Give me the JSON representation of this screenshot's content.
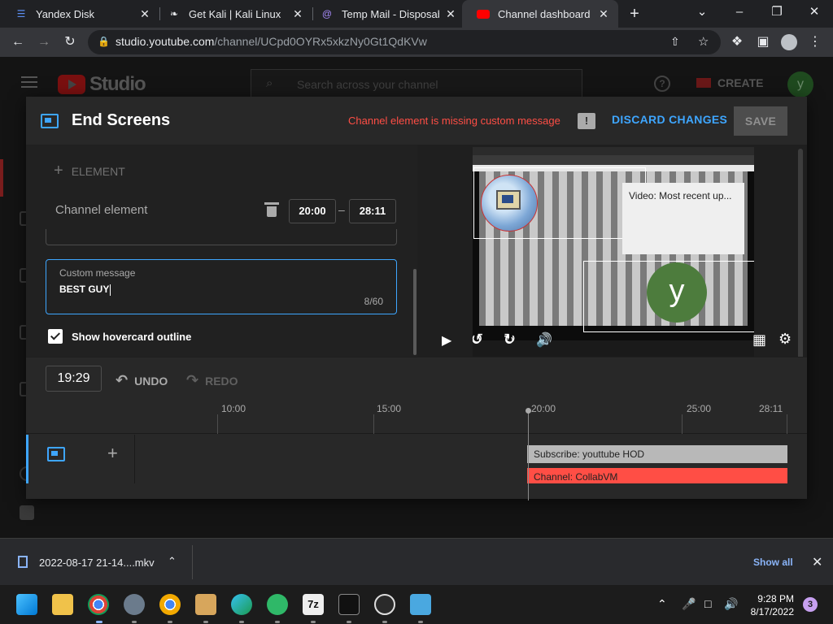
{
  "browser": {
    "tabs": [
      {
        "label": "Yandex Disk",
        "favicon": "yandex-disk-icon",
        "color": "#5b8def",
        "active": false
      },
      {
        "label": "Get Kali | Kali Linux",
        "favicon": "kali-dragon-icon",
        "color": "#e8eaed",
        "active": false
      },
      {
        "label": "Temp Mail - Disposable",
        "favicon": "at-sign-icon",
        "color": "#a78bfa",
        "active": false
      },
      {
        "label": "Channel dashboard - Y",
        "favicon": "youtube-icon",
        "color": "#ff0000",
        "active": true
      }
    ],
    "url_host": "studio.youtube.com",
    "url_path": "/channel/UCpd0OYRx5xkzNy0Gt1QdKVw"
  },
  "studio": {
    "brand": "Studio",
    "search_placeholder": "Search across your channel",
    "create_label": "CREATE",
    "avatar_letter": "y"
  },
  "dialog": {
    "title": "End Screens",
    "error": "Channel element is missing custom message",
    "discard_label": "DISCARD CHANGES",
    "save_label": "SAVE",
    "add_element_label": "ELEMENT",
    "element_name": "Channel element",
    "start_time": "20:00",
    "end_time": "28:11",
    "custom_message_label": "Custom message",
    "custom_message_value": "BEST GUY",
    "custom_message_count": "8/60",
    "hovercard_label": "Show hovercard outline",
    "hovercard_checked": true
  },
  "preview": {
    "video_card_text": "Video: Most recent up...",
    "subscribe_letter": "y"
  },
  "timeline": {
    "current_time": "19:29",
    "undo_label": "UNDO",
    "redo_label": "REDO",
    "ticks": [
      "10:00",
      "15:00",
      "20:00",
      "25:00",
      "28:11"
    ],
    "bars": {
      "subscribe": "Subscribe: youttube HOD",
      "channel": "Channel: CollabVM"
    }
  },
  "downloads": {
    "file_name": "2022-08-17 21-14....mkv",
    "show_all_label": "Show all"
  },
  "taskbar": {
    "time": "9:28 PM",
    "date": "8/17/2022",
    "notification_count": "3"
  },
  "colors": {
    "accent": "#3ea6ff",
    "error": "#ff4e45"
  }
}
